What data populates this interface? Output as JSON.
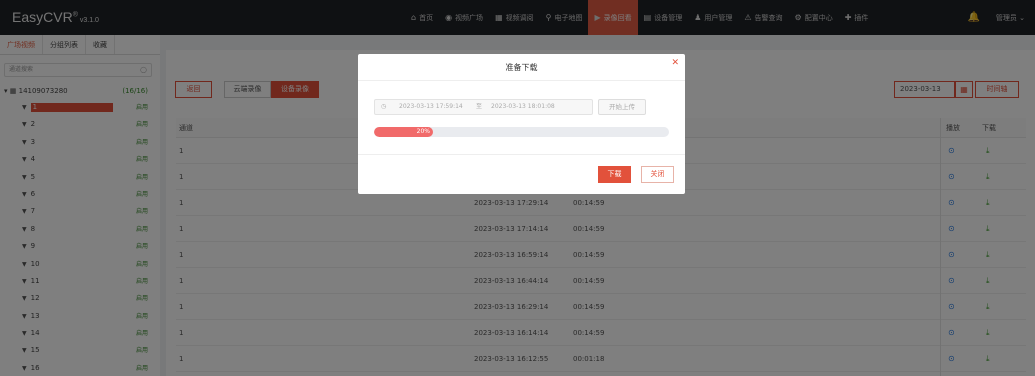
{
  "app": {
    "name": "EasyCVR",
    "registered": "®",
    "version": "v3.1.0"
  },
  "nav": {
    "items": [
      {
        "label": "首页",
        "icon": "home-icon"
      },
      {
        "label": "视频广场",
        "icon": "play-circle-icon"
      },
      {
        "label": "视频调阅",
        "icon": "grid-icon"
      },
      {
        "label": "电子地图",
        "icon": "map-pin-icon"
      },
      {
        "label": "录像回看",
        "icon": "video-icon",
        "active": true
      },
      {
        "label": "设备管理",
        "icon": "device-icon"
      },
      {
        "label": "用户管理",
        "icon": "user-icon"
      },
      {
        "label": "告警查询",
        "icon": "alarm-icon"
      },
      {
        "label": "配置中心",
        "icon": "gear-icon"
      },
      {
        "label": "插件",
        "icon": "plugin-icon"
      }
    ],
    "user": "管理员"
  },
  "sidebar": {
    "tabs": [
      "广场视频",
      "分组列表",
      "收藏"
    ],
    "search_placeholder": "通道搜索",
    "group": {
      "name": "14109073280",
      "count": "(16/16)"
    },
    "channels": [
      {
        "label": "1",
        "status": "启用"
      },
      {
        "label": "2",
        "status": "启用"
      },
      {
        "label": "3",
        "status": "启用"
      },
      {
        "label": "4",
        "status": "启用"
      },
      {
        "label": "5",
        "status": "启用"
      },
      {
        "label": "6",
        "status": "启用"
      },
      {
        "label": "7",
        "status": "启用"
      },
      {
        "label": "8",
        "status": "启用"
      },
      {
        "label": "9",
        "status": "启用"
      },
      {
        "label": "10",
        "status": "启用"
      },
      {
        "label": "11",
        "status": "启用"
      },
      {
        "label": "12",
        "status": "启用"
      },
      {
        "label": "13",
        "status": "启用"
      },
      {
        "label": "14",
        "status": "启用"
      },
      {
        "label": "15",
        "status": "启用"
      },
      {
        "label": "16",
        "status": "启用"
      }
    ]
  },
  "toolbar": {
    "back": "返回",
    "cloud": "云端录像",
    "device": "设备录像",
    "date": "2023-03-13",
    "timeline": "时间轴"
  },
  "table": {
    "headers": {
      "channel": "通道",
      "play": "播放",
      "download": "下载"
    },
    "rows": [
      {
        "channel": "1",
        "start": "",
        "duration": ""
      },
      {
        "channel": "1",
        "start": "",
        "duration": ""
      },
      {
        "channel": "1",
        "start": "2023-03-13 17:29:14",
        "duration": "00:14:59"
      },
      {
        "channel": "1",
        "start": "2023-03-13 17:14:14",
        "duration": "00:14:59"
      },
      {
        "channel": "1",
        "start": "2023-03-13 16:59:14",
        "duration": "00:14:59"
      },
      {
        "channel": "1",
        "start": "2023-03-13 16:44:14",
        "duration": "00:14:59"
      },
      {
        "channel": "1",
        "start": "2023-03-13 16:29:14",
        "duration": "00:14:59"
      },
      {
        "channel": "1",
        "start": "2023-03-13 16:14:14",
        "duration": "00:14:59"
      },
      {
        "channel": "1",
        "start": "2023-03-13 16:12:55",
        "duration": "00:01:18"
      }
    ]
  },
  "modal": {
    "title": "准备下载",
    "start_time": "2023-03-13 17:59:14",
    "range_sep": "至",
    "end_time": "2023-03-13 18:01:08",
    "upload": "开始上传",
    "progress_percent": 20,
    "progress_label": "20%",
    "download": "下载",
    "close": "关闭"
  },
  "colors": {
    "accent": "#e2513b",
    "enabled": "#3a8a2e",
    "play": "#2b7de0"
  }
}
